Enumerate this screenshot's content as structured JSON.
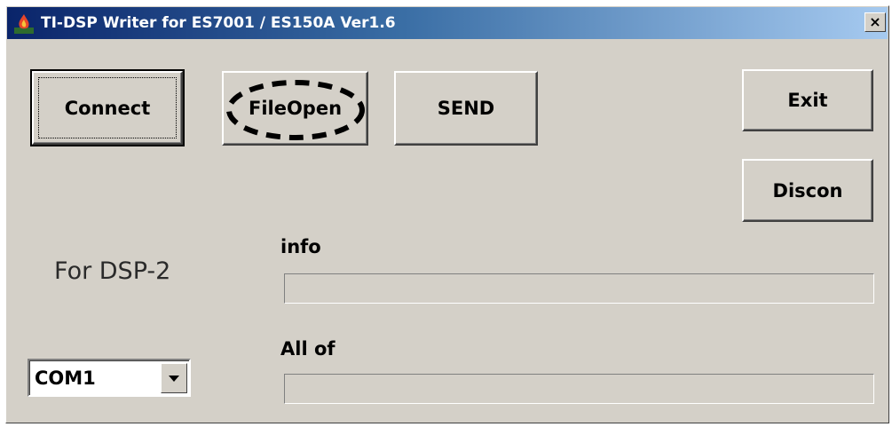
{
  "window": {
    "title": "TI-DSP Writer for ES7001 / ES150A Ver1.6",
    "close_label": "×",
    "icon": "flame-app-icon"
  },
  "buttons": {
    "connect": "Connect",
    "file_open": "FileOpen",
    "send": "SEND",
    "exit": "Exit",
    "discon": "Discon"
  },
  "labels": {
    "target": "For DSP-2",
    "info": "info",
    "all_of": "All of"
  },
  "progress": {
    "info_value": 0,
    "all_of_value": 0
  },
  "port_select": {
    "selected": "COM1"
  },
  "annotation": {
    "highlight_color": "#000000",
    "highlighted_control": "FileOpen"
  }
}
